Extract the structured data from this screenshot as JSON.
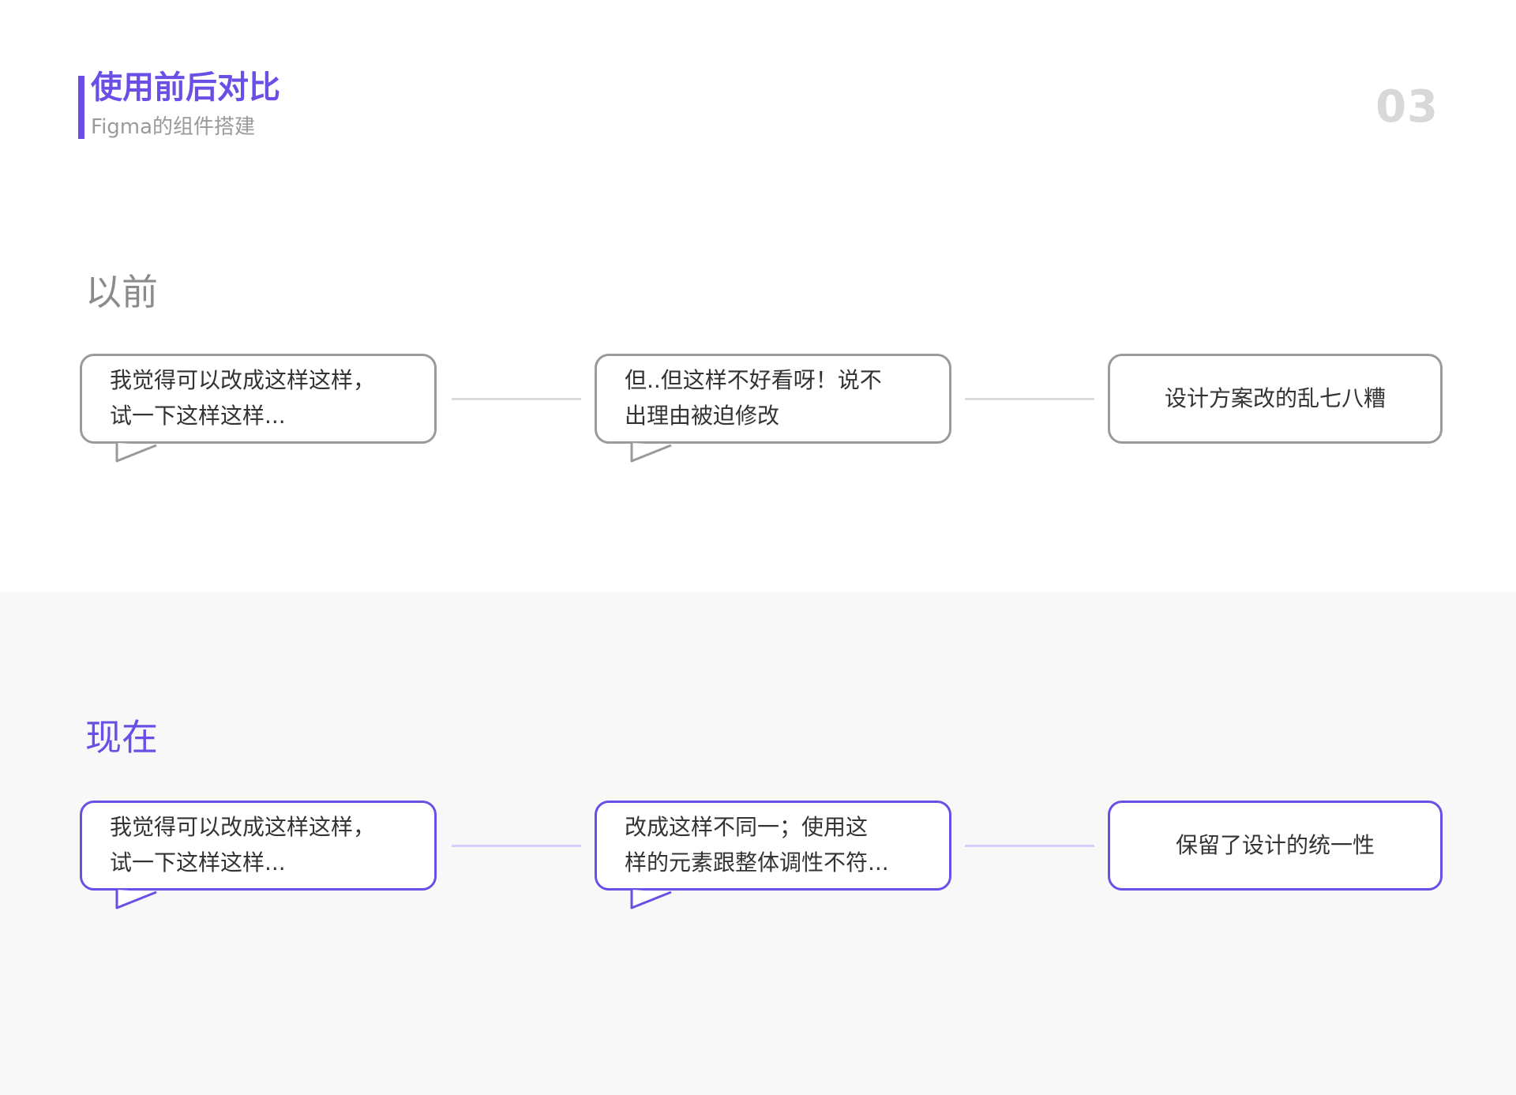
{
  "header": {
    "title": "使用前后对比",
    "subtitle": "Figma的组件搭建",
    "page_number": "03"
  },
  "sections": [
    {
      "title": "以前",
      "color": "#8b8b8b",
      "nodes": [
        {
          "text": "我觉得可以改成这样这样，\n试一下这样这样..."
        },
        {
          "text": "但..但这样不好看呀！说不\n出理由被迫修改"
        },
        {
          "text": "设计方案改的乱七八糟"
        }
      ]
    },
    {
      "title": "现在",
      "color": "#6b4ee6",
      "nodes": [
        {
          "text": "我觉得可以改成这样这样，\n试一下这样这样..."
        },
        {
          "text": "改成这样不同一；使用这\n样的元素跟整体调性不符..."
        },
        {
          "text": "保留了设计的统一性"
        }
      ]
    }
  ],
  "colors": {
    "accent": "#6b4ee6",
    "gray_border": "#9a9a9a",
    "light_gray": "#dcdcdc",
    "light_purple": "#d7cefb"
  }
}
